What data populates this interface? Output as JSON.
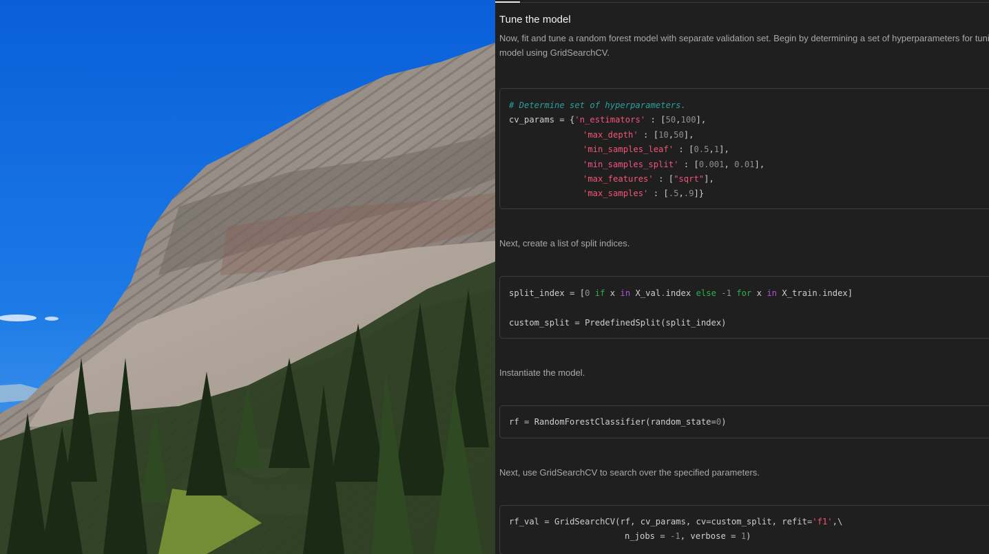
{
  "photo": {
    "description_icon": "mountain-photo"
  },
  "notebook": {
    "heading": "Tune the model",
    "intro_line1": "Now, fit and tune a random forest model with separate validation set. Begin by determining a set of hyperparameters for tuning",
    "intro_line2": "model using GridSearchCV.",
    "cell1": {
      "comment": "# Determine set of hyperparameters.",
      "l2a": "cv_params = {",
      "l2b": "'n_estimators'",
      "l2c": " : [",
      "l2d": "50",
      "l2e": ",",
      "l2f": "100",
      "l2g": "],",
      "l3a": "'max_depth'",
      "l3b": " : [",
      "l3c": "10",
      "l3d": ",",
      "l3e": "50",
      "l3f": "],",
      "l4a": "'min_samples_leaf'",
      "l4b": " : [",
      "l4c": "0.5",
      "l4d": ",",
      "l4e": "1",
      "l4f": "],",
      "l5a": "'min_samples_split'",
      "l5b": " : [",
      "l5c": "0.001",
      "l5d": ", ",
      "l5e": "0.01",
      "l5f": "],",
      "l6a": "'max_features'",
      "l6b": " : [",
      "l6c": "\"sqrt\"",
      "l6d": "],",
      "l7a": "'max_samples'",
      "l7b": " : [",
      "l7c": ".5",
      "l7d": ",",
      "l7e": ".9",
      "l7f": "]}"
    },
    "text2": "Next, create a list of split indices.",
    "cell2": {
      "a": "split_index ",
      "b": "=",
      "c": " [",
      "d": "0",
      "e": " ",
      "f": "if",
      "g": " x ",
      "h": "in",
      "i": " X_val",
      "j": ".",
      "k": "index ",
      "l": "else",
      "m": " ",
      "n": "-1",
      "o": " ",
      "p": "for",
      "q": " x ",
      "r": "in",
      "s": " X_train",
      "t": ".",
      "u": "index]",
      "line2a": "custom_split ",
      "line2b": "=",
      "line2c": " PredefinedSplit(split_index)"
    },
    "text3": "Instantiate the model.",
    "cell3": {
      "a": "rf ",
      "b": "=",
      "c": " RandomForestClassifier(random_state",
      "d": "=",
      "e": "0",
      "f": ")"
    },
    "text4": "Next, use GridSearchCV to search over the specified parameters.",
    "cell4": {
      "a": "rf_val ",
      "b": "=",
      "c": " GridSearchCV(rf, cv_params, cv",
      "d": "=",
      "e": "custom_split, refit",
      "f": "=",
      "g": "'f1'",
      "h": ",\\",
      "l2a": "n_jobs ",
      "l2b": "=",
      "l2c": " ",
      "l2d": "-1",
      "l2e": ", verbose ",
      "l2f": "=",
      "l2g": " ",
      "l2h": "1",
      "l2i": ")"
    }
  }
}
